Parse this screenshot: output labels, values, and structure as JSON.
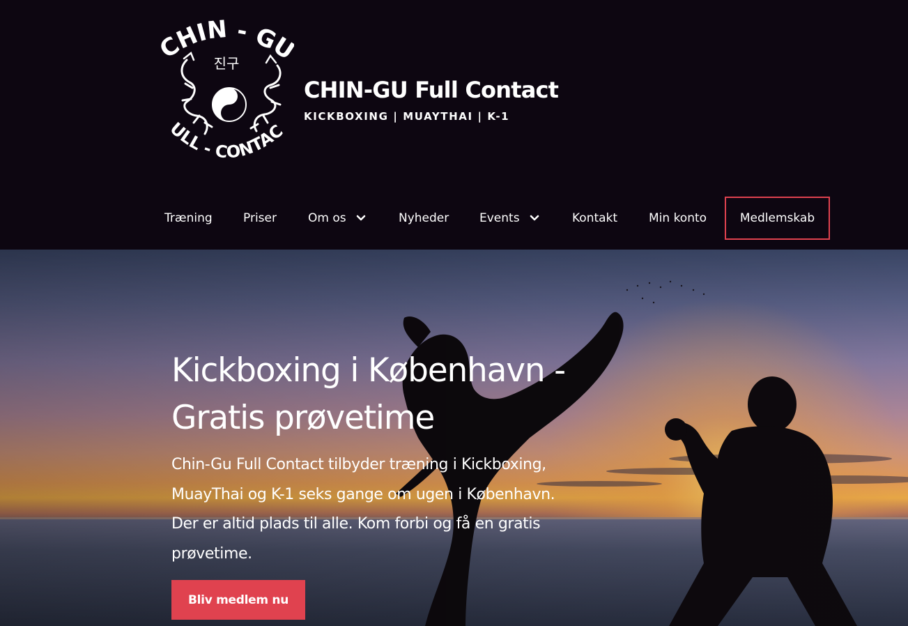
{
  "site": {
    "title": "CHIN-GU Full Contact",
    "tagline": "KICKBOXING | MUAYTHAI | K-1",
    "logo": {
      "top_text": "CHIN - GU",
      "korean_text": "진구",
      "bottom_text": "FULL - CONTACT",
      "icon": "dragon-yin-yang-logo"
    }
  },
  "nav": {
    "items": [
      {
        "label": "Træning",
        "has_dropdown": false
      },
      {
        "label": "Priser",
        "has_dropdown": false
      },
      {
        "label": "Om os",
        "has_dropdown": true
      },
      {
        "label": "Nyheder",
        "has_dropdown": false
      },
      {
        "label": "Events",
        "has_dropdown": true
      },
      {
        "label": "Kontakt",
        "has_dropdown": false
      },
      {
        "label": "Min konto",
        "has_dropdown": false
      }
    ],
    "cta_label": "Medlemskab"
  },
  "hero": {
    "heading": "Kickboxing i København - Gratis prøvetime",
    "text": "Chin-Gu Full Contact tilbyder træning i Kickboxing, MuayThai og K-1 seks gange om ugen i København. Der er altid plads til alle. Kom forbi og få en gratis prøvetime.",
    "button_label": "Bliv medlem nu"
  },
  "colors": {
    "header_bg": "#0d0611",
    "accent": "#e0424f",
    "text": "#ffffff"
  }
}
